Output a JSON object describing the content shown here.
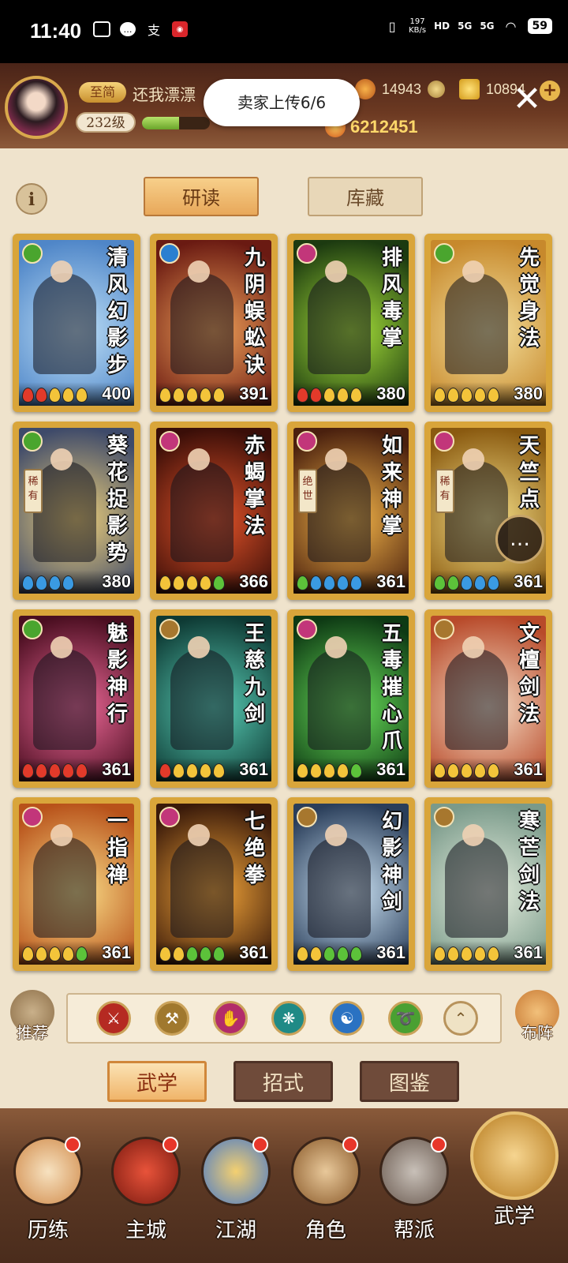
{
  "status_bar": {
    "time": "11:40",
    "net_speed_value": "197",
    "net_speed_unit": "KB/s",
    "hd_label": "HD",
    "signal1": "5G",
    "signal2": "5G",
    "battery": "59"
  },
  "header": {
    "vip_label": "至简",
    "player_name": "还我漂漂",
    "level": "232级",
    "exp_fraction": 0.55,
    "coins": "14943",
    "gold": "10894",
    "power": "6212451",
    "toast": "卖家上传6/6"
  },
  "tabs": {
    "study": "研读",
    "storage": "库藏"
  },
  "colors": {
    "red": "#c8342a",
    "blue": "#2a7fd0",
    "pink": "#c2367a",
    "green": "#4aa52e",
    "bronze": "#a7772e",
    "teal": "#238c8a"
  },
  "cards": [
    {
      "name": "清风幻影步",
      "power": "400",
      "rarity": "",
      "icon": "green",
      "pips": [
        "red",
        "red",
        "gold",
        "gold",
        "gold"
      ],
      "bg": [
        "#bfe0f7",
        "#4f86c8"
      ]
    },
    {
      "name": "九阴蜈蚣诀",
      "power": "391",
      "rarity": "",
      "icon": "blue",
      "pips": [
        "gold",
        "gold",
        "gold",
        "gold",
        "gold"
      ],
      "bg": [
        "#f2a35a",
        "#6a1a12"
      ]
    },
    {
      "name": "排风毒掌",
      "power": "380",
      "rarity": "",
      "icon": "pink",
      "pips": [
        "red",
        "red",
        "gold",
        "gold",
        "gold"
      ],
      "bg": [
        "#a8e23a",
        "#1c3a10"
      ]
    },
    {
      "name": "先觉身法",
      "power": "380",
      "rarity": "",
      "icon": "green",
      "pips": [
        "gold",
        "gold",
        "gold",
        "gold",
        "gold"
      ],
      "bg": [
        "#f5e2a0",
        "#c7892c"
      ]
    },
    {
      "name": "葵花捉影势",
      "power": "380",
      "rarity": "稀有",
      "icon": "green",
      "pips": [
        "blue",
        "blue",
        "blue",
        "blue"
      ],
      "bg": [
        "#f1d27a",
        "#3e4a6a"
      ]
    },
    {
      "name": "赤蝎掌法",
      "power": "366",
      "rarity": "",
      "icon": "pink",
      "pips": [
        "gold",
        "gold",
        "gold",
        "gold",
        "green"
      ],
      "bg": [
        "#e8552a",
        "#3a0e08"
      ]
    },
    {
      "name": "如来神掌",
      "power": "361",
      "rarity": "绝世",
      "icon": "pink",
      "pips": [
        "green",
        "blue",
        "blue",
        "blue",
        "blue"
      ],
      "bg": [
        "#f7b84a",
        "#4a200e"
      ]
    },
    {
      "name": "天竺点",
      "power": "361",
      "rarity": "稀有",
      "icon": "pink",
      "pips": [
        "green",
        "green",
        "blue",
        "blue",
        "blue"
      ],
      "bg": [
        "#f7e28a",
        "#8a5a10"
      ]
    },
    {
      "name": "魅影神行",
      "power": "361",
      "rarity": "",
      "icon": "green",
      "pips": [
        "red",
        "red",
        "red",
        "red",
        "red"
      ],
      "bg": [
        "#f06a9a",
        "#4a0e20"
      ]
    },
    {
      "name": "王慈九剑",
      "power": "361",
      "rarity": "",
      "icon": "bronze",
      "pips": [
        "red",
        "gold",
        "gold",
        "gold",
        "gold"
      ],
      "bg": [
        "#5ad0b8",
        "#0e3a34"
      ]
    },
    {
      "name": "五毒摧心爪",
      "power": "361",
      "rarity": "",
      "icon": "pink",
      "pips": [
        "gold",
        "gold",
        "gold",
        "gold",
        "green"
      ],
      "bg": [
        "#6ae25a",
        "#0e3a14"
      ]
    },
    {
      "name": "文檀剑法",
      "power": "361",
      "rarity": "",
      "icon": "bronze",
      "pips": [
        "gold",
        "gold",
        "gold",
        "gold",
        "gold"
      ],
      "bg": [
        "#f7e0c8",
        "#b84a2a"
      ]
    },
    {
      "name": "一指禅",
      "power": "361",
      "rarity": "",
      "icon": "pink",
      "pips": [
        "gold",
        "gold",
        "gold",
        "gold",
        "green"
      ],
      "bg": [
        "#fbe08a",
        "#b8521a"
      ]
    },
    {
      "name": "七绝拳",
      "power": "361",
      "rarity": "",
      "icon": "pink",
      "pips": [
        "gold",
        "gold",
        "green",
        "green",
        "green"
      ],
      "bg": [
        "#f7a83a",
        "#3a1a0a"
      ]
    },
    {
      "name": "幻影神剑",
      "power": "361",
      "rarity": "",
      "icon": "bronze",
      "pips": [
        "gold",
        "gold",
        "green",
        "green",
        "green"
      ],
      "bg": [
        "#cfe6f7",
        "#2a3e5a"
      ]
    },
    {
      "name": "寒芒剑法",
      "power": "361",
      "rarity": "",
      "icon": "bronze",
      "pips": [
        "gold",
        "gold",
        "gold",
        "gold",
        "gold"
      ],
      "bg": [
        "#e8f0e0",
        "#7a9a8a"
      ]
    }
  ],
  "filter": {
    "recommend": "推荐",
    "formation": "布阵",
    "categories": [
      "sword-red",
      "blade-bronze",
      "palm-pink",
      "fan-teal",
      "yin-yang-blue",
      "movement-green",
      "up-arrow"
    ]
  },
  "bottom_tabs": [
    "武学",
    "招式",
    "图鉴"
  ],
  "nav": [
    "历练",
    "主城",
    "江湖",
    "角色",
    "帮派",
    "武学"
  ]
}
